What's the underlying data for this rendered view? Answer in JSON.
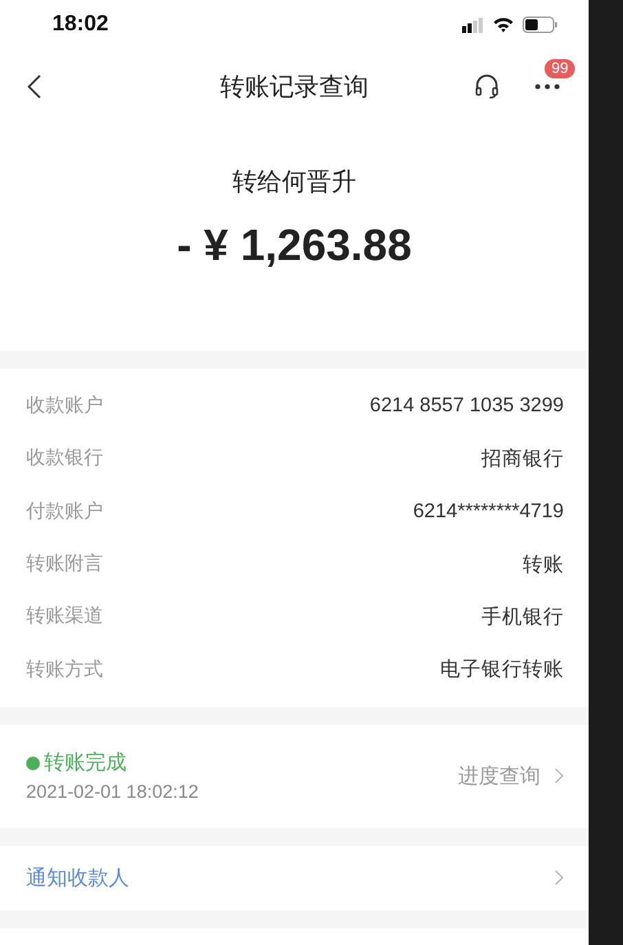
{
  "status_bar": {
    "time": "18:02"
  },
  "nav": {
    "title": "转账记录查询",
    "badge": "99"
  },
  "header": {
    "payee_line": "转给何晋升",
    "amount": "- ¥ 1,263.88"
  },
  "details": [
    {
      "label": "收款账户",
      "value": "6214 8557 1035 3299"
    },
    {
      "label": "收款银行",
      "value": "招商银行"
    },
    {
      "label": "付款账户",
      "value": "6214********4719"
    },
    {
      "label": "转账附言",
      "value": "转账"
    },
    {
      "label": "转账渠道",
      "value": "手机银行"
    },
    {
      "label": "转账方式",
      "value": "电子银行转账"
    }
  ],
  "progress": {
    "status": "转账完成",
    "time": "2021-02-01 18:02:12",
    "link": "进度查询"
  },
  "notify": {
    "label": "通知收款人"
  }
}
